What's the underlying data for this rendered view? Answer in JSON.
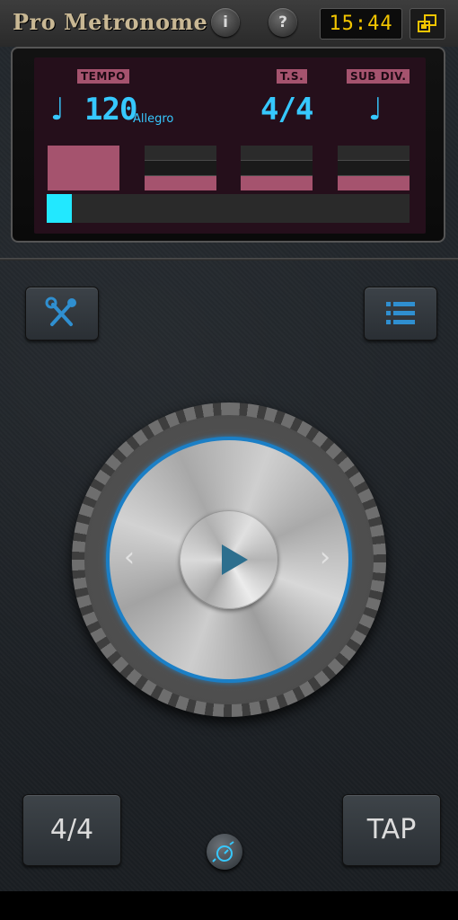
{
  "header": {
    "app_name": "Pro Metronome",
    "info_label": "i",
    "help_label": "?",
    "clock": "15:44"
  },
  "display": {
    "tempo_tag": "TEMPO",
    "tempo_value": "120",
    "tempo_marking": "Allegro",
    "ts_tag": "T.S.",
    "time_signature": "4/4",
    "subdiv_tag": "SUB DIV.",
    "note_glyph": "♩",
    "beat_progress": 0.07
  },
  "controls": {
    "time_signature_button": "4/4",
    "tap_button": "TAP"
  },
  "icons": {
    "settings": "wrench-screwdriver-icon",
    "menu": "list-icon",
    "play": "play-icon",
    "prev": "chevron-left-icon",
    "next": "chevron-right-icon",
    "speed": "stopwatch-icon",
    "layout": "layout-toggle-icon"
  },
  "colors": {
    "accent_blue": "#36c8ff",
    "active_beat": "#a5536e",
    "clock_yellow": "#f2c500",
    "progress_cyan": "#22e8ff",
    "dial_ring": "#1b7fc6"
  }
}
